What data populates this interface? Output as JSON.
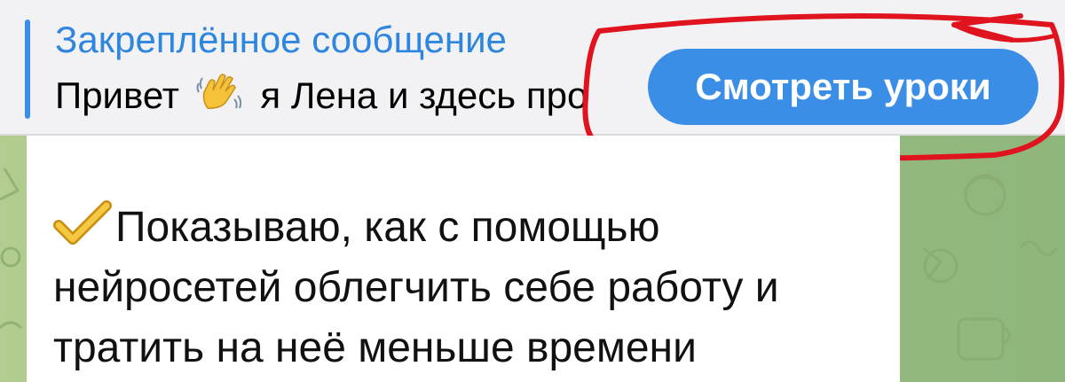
{
  "pinned": {
    "title": "Закреплённое сообщение",
    "preview_before_emoji": "Привет",
    "preview_after_emoji": "я Лена и здесь про",
    "button_label": "Смотреть уроки",
    "emoji": "waving-hand-icon"
  },
  "message": {
    "line1": "Показываю, как с помощью",
    "line2": "нейросетей облегчить себе работу и",
    "line3": "тратить на неё меньше времени",
    "emoji": "check-mark-icon"
  },
  "colors": {
    "accent": "#3a8ee6",
    "annotation": "#e0141e",
    "chat_background": "#9ebf83"
  }
}
